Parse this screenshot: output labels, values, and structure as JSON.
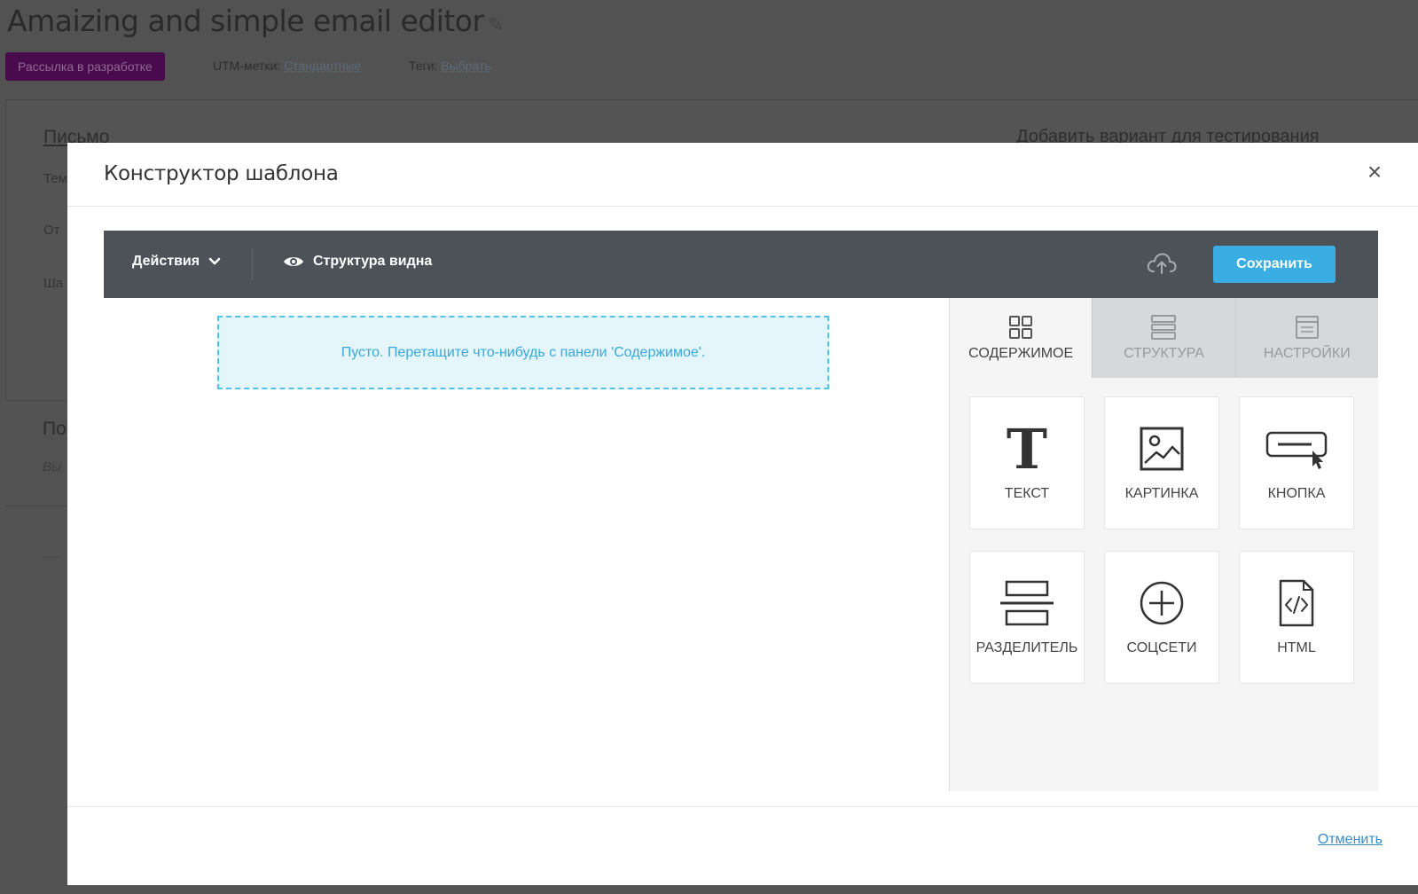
{
  "background_page": {
    "title": "Amaizing and simple email editor",
    "status_badge": "Рассылка в разработке",
    "utm_label": "UTM-метки:",
    "utm_value": "Стандартные",
    "tags_label": "Теги:",
    "tags_value": "Выбрать",
    "letter_heading": "Письмо",
    "row1": "Тема",
    "row2": "От",
    "row3": "Ша",
    "section2_heading": "По",
    "section2_sub": "Вы",
    "right_heading": "Добавить вариант для тестирования"
  },
  "modal": {
    "title": "Конструктор шаблона",
    "close_glyph": "×",
    "toolbar": {
      "actions_label": "Действия",
      "structure_label": "Структура видна",
      "save_label": "Сохранить"
    },
    "dropzone_text": "Пусто. Перетащите что-нибудь с панели 'Содержимое'.",
    "tabs": [
      {
        "label": "СОДЕРЖИМОЕ",
        "icon": "grid-icon",
        "active": true
      },
      {
        "label": "СТРУКТУРА",
        "icon": "rows-icon",
        "active": false
      },
      {
        "label": "НАСТРОЙКИ",
        "icon": "settings-doc-icon",
        "active": false
      }
    ],
    "tiles": [
      {
        "label": "ТЕКСТ",
        "icon": "text-icon"
      },
      {
        "label": "КАРТИНКА",
        "icon": "image-icon"
      },
      {
        "label": "КНОПКА",
        "icon": "button-icon"
      },
      {
        "label": "РАЗДЕЛИТЕЛЬ",
        "icon": "divider-icon"
      },
      {
        "label": "СОЦСЕТИ",
        "icon": "social-plus-icon"
      },
      {
        "label": "HTML",
        "icon": "html-code-icon"
      }
    ],
    "cancel_label": "Отменить"
  },
  "colors": {
    "overlay": "#525252",
    "toolbar": "#4c5258",
    "save_button": "#3aaee2",
    "dropzone_border": "#53c3e8",
    "dropzone_bg": "#e4f5fb",
    "badge": "#4a0a4e",
    "link": "#3a8cc4"
  }
}
